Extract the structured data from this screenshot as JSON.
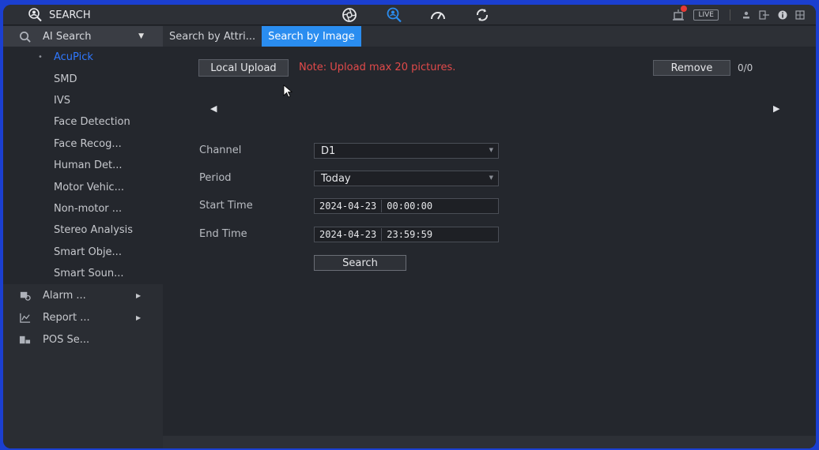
{
  "topbar": {
    "title": "SEARCH",
    "live_label": "LIVE",
    "nav_icons": [
      "camera-lens-icon",
      "search-person-icon",
      "performance-gauge-icon",
      "sync-icon"
    ],
    "right_icons": [
      "alarm-icon",
      "live-view-icon",
      "user-icon",
      "logout-icon",
      "info-icon",
      "grid-icon"
    ]
  },
  "sidebar": {
    "ai_search": "AI Search",
    "sub_items": [
      {
        "label": "AcuPick",
        "active": true
      },
      {
        "label": "SMD"
      },
      {
        "label": "IVS"
      },
      {
        "label": "Face Detection"
      },
      {
        "label": "Face Recog..."
      },
      {
        "label": "Human Det..."
      },
      {
        "label": "Motor Vehic..."
      },
      {
        "label": "Non-motor ..."
      },
      {
        "label": "Stereo Analysis"
      },
      {
        "label": "Smart Obje..."
      },
      {
        "label": "Smart Soun..."
      }
    ],
    "groups": [
      {
        "label": "Alarm ...",
        "icon": "alarm-search-icon"
      },
      {
        "label": "Report ...",
        "icon": "chart-icon"
      },
      {
        "label": "POS Se...",
        "icon": "pos-terminal-icon"
      }
    ]
  },
  "tabs": [
    {
      "label": "Search by Attri...",
      "active": false
    },
    {
      "label": "Search by Image",
      "active": true
    }
  ],
  "upload": {
    "button_label": "Local Upload",
    "note": "Note: Upload max 20 pictures.",
    "remove_label": "Remove",
    "count": "0/0"
  },
  "form": {
    "channel_label": "Channel",
    "channel_value": "D1",
    "period_label": "Period",
    "period_value": "Today",
    "start_label": "Start Time",
    "start_date": "2024-04-23",
    "start_time": "00:00:00",
    "end_label": "End Time",
    "end_date": "2024-04-23",
    "end_time": "23:59:59",
    "search_label": "Search"
  },
  "colors": {
    "accent": "#2a8df0",
    "active_text": "#2f78ff",
    "note": "#e24a4a",
    "outer_border": "#1b3fd0"
  }
}
